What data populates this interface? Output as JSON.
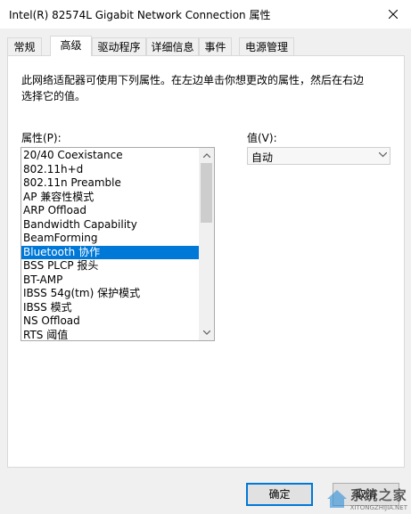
{
  "window": {
    "title": "Intel(R) 82574L Gigabit Network Connection 属性"
  },
  "tabs": [
    {
      "label": "常规",
      "active": false
    },
    {
      "label": "高级",
      "active": true
    },
    {
      "label": "驱动程序",
      "active": false
    },
    {
      "label": "详细信息",
      "active": false
    },
    {
      "label": "事件",
      "active": false
    },
    {
      "label": "电源管理",
      "active": false
    }
  ],
  "panel": {
    "description": "此网络适配器可使用下列属性。在左边单击你想更改的属性，然后在右边选择它的值。",
    "property_label": "属性(P):",
    "value_label": "值(V):",
    "properties": [
      "20/40 Coexistance",
      "802.11h+d",
      "802.11n Preamble",
      "AP 兼容性模式",
      "ARP Offload",
      "Bandwidth Capability",
      "BeamForming",
      "Bluetooth 协作",
      "BSS PLCP 报头",
      "BT-AMP",
      "IBSS 54g(tm) 保护模式",
      "IBSS 模式",
      "NS Offload",
      "RTS 阈值"
    ],
    "selected_index": 7,
    "value_selected": "自动"
  },
  "buttons": {
    "ok": "确定",
    "cancel": "取消"
  },
  "watermark": {
    "title": "系统之家",
    "url": "XITONGZHIJIA.NET"
  },
  "colors": {
    "selection": "#0078d7",
    "panel": "#ffffff",
    "dialog": "#f0f0f0"
  }
}
